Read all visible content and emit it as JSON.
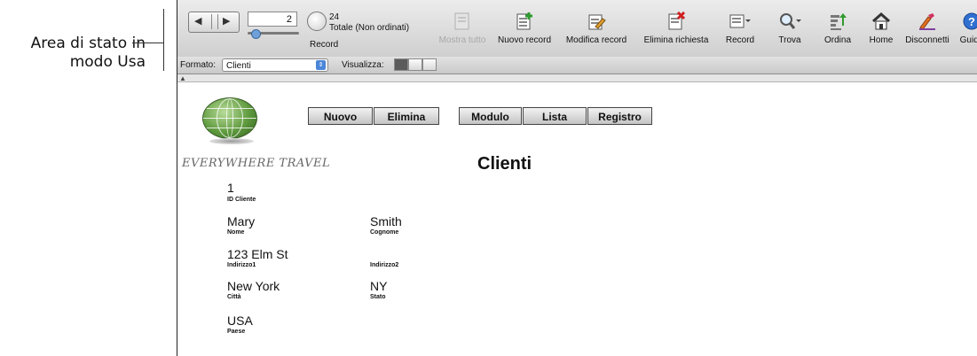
{
  "annotation": {
    "line1": "Area di stato in",
    "line2": "modo Usa"
  },
  "status": {
    "current_record": "2",
    "total_count": "24",
    "total_label": "Totale (Non ordinati)",
    "record_label": "Record"
  },
  "toolbar": [
    {
      "label": "Mostra tutto",
      "icon": "show-all-icon",
      "disabled": true
    },
    {
      "label": "Nuovo record",
      "icon": "new-record-icon"
    },
    {
      "label": "Modifica record",
      "icon": "edit-record-icon"
    },
    {
      "label": "Elimina richiesta",
      "icon": "delete-request-icon"
    },
    {
      "label": "Record",
      "icon": "records-menu-icon"
    },
    {
      "label": "Trova",
      "icon": "find-icon"
    },
    {
      "label": "Ordina",
      "icon": "sort-icon"
    },
    {
      "label": "Home",
      "icon": "home-icon"
    },
    {
      "label": "Disconnetti",
      "icon": "disconnect-icon"
    },
    {
      "label": "Guida",
      "icon": "help-icon"
    }
  ],
  "layout_bar": {
    "format_label": "Formato:",
    "format_value": "Clienti",
    "view_label": "Visualizza:"
  },
  "form": {
    "brand": "EVERYWHERE TRAVEL",
    "buttons": {
      "new": "Nuovo",
      "delete": "Elimina",
      "form": "Modulo",
      "list": "Lista",
      "table": "Registro"
    },
    "title": "Clienti",
    "fields": {
      "id": {
        "value": "1",
        "label": "ID Cliente"
      },
      "first_name": {
        "value": "Mary",
        "label": "Nome"
      },
      "last_name": {
        "value": "Smith",
        "label": "Cognome"
      },
      "address1": {
        "value": "123 Elm St",
        "label": "Indirizzo1"
      },
      "address2": {
        "value": "",
        "label": "Indirizzo2"
      },
      "city": {
        "value": "New York",
        "label": "Città"
      },
      "state": {
        "value": "NY",
        "label": "Stato"
      },
      "country": {
        "value": "USA",
        "label": "Paese"
      }
    }
  },
  "colors": {
    "toolbar_top": "#ececec",
    "toolbar_bottom": "#cfcfcf",
    "accent": "#4a86d8"
  }
}
